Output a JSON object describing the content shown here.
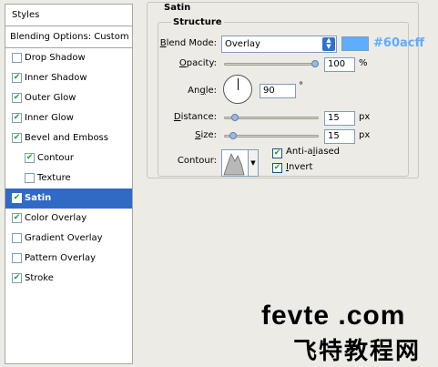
{
  "sidebar": {
    "styles_label": "Styles",
    "blending_label": "Blending Options: Custom",
    "items": [
      {
        "label": "Drop Shadow",
        "checked": false,
        "indent": false,
        "selected": false
      },
      {
        "label": "Inner Shadow",
        "checked": true,
        "indent": false,
        "selected": false
      },
      {
        "label": "Outer Glow",
        "checked": true,
        "indent": false,
        "selected": false
      },
      {
        "label": "Inner Glow",
        "checked": true,
        "indent": false,
        "selected": false
      },
      {
        "label": "Bevel and Emboss",
        "checked": true,
        "indent": false,
        "selected": false
      },
      {
        "label": "Contour",
        "checked": true,
        "indent": true,
        "selected": false
      },
      {
        "label": "Texture",
        "checked": false,
        "indent": true,
        "selected": false
      },
      {
        "label": "Satin",
        "checked": true,
        "indent": false,
        "selected": true
      },
      {
        "label": "Color Overlay",
        "checked": true,
        "indent": false,
        "selected": false
      },
      {
        "label": "Gradient Overlay",
        "checked": false,
        "indent": false,
        "selected": false
      },
      {
        "label": "Pattern Overlay",
        "checked": false,
        "indent": false,
        "selected": false
      },
      {
        "label": "Stroke",
        "checked": true,
        "indent": false,
        "selected": false
      }
    ]
  },
  "panel": {
    "title": "Satin",
    "structure_title": "Structure",
    "blend_mode": {
      "label_underlined": "B",
      "label_rest": "lend Mode:",
      "value": "Overlay",
      "color": "#60acff",
      "color_text": "#60acff"
    },
    "opacity": {
      "label_underlined": "O",
      "label_rest": "pacity:",
      "value": "100",
      "unit": "%",
      "fraction": 1.0
    },
    "angle": {
      "label_pre": "An",
      "label_underlined": "g",
      "label_rest": "le:",
      "value": "90",
      "unit": "°"
    },
    "distance": {
      "label_underlined": "D",
      "label_rest": "istance:",
      "value": "15",
      "unit": "px",
      "fraction": 0.08
    },
    "size": {
      "label_underlined": "S",
      "label_rest": "ize:",
      "value": "15",
      "unit": "px",
      "fraction": 0.06
    },
    "contour": {
      "label": "Contour:"
    },
    "anti_aliased": {
      "label_pre": "Anti-a",
      "label_underlined": "l",
      "label_rest": "iased",
      "checked": true
    },
    "invert": {
      "label_underlined": "I",
      "label_rest": "nvert",
      "checked": true
    }
  },
  "watermark": {
    "line1": "fevte .com",
    "line2": "飞特教程网"
  }
}
